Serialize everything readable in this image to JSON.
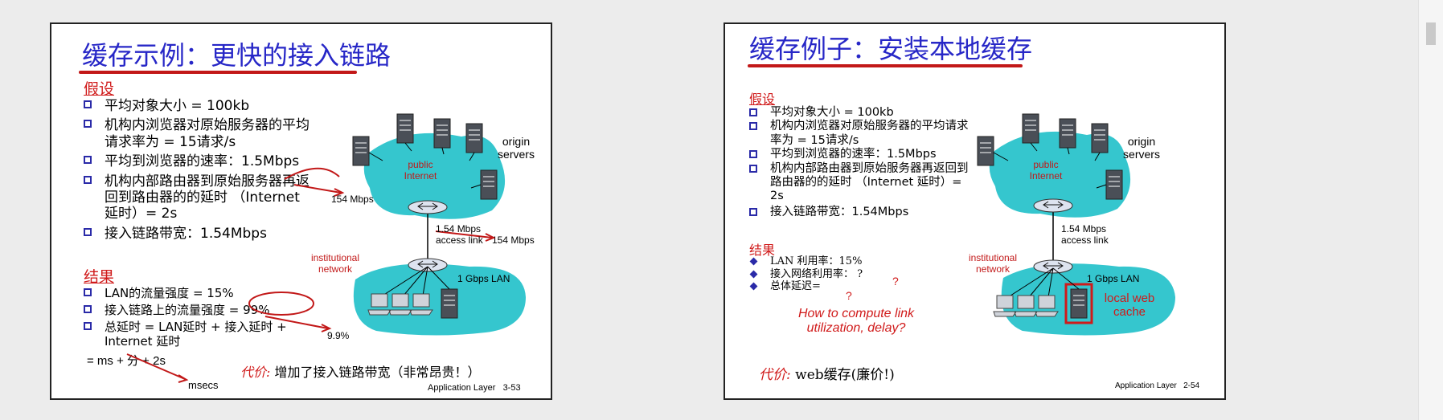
{
  "colors": {
    "title": "#2727c7",
    "accent": "#d01a1a",
    "cloud": "#35c6ce",
    "bullet": "#2a2aa8"
  },
  "slide1": {
    "title": "缓存示例：更快的接入链路",
    "assumptions_heading": "假设",
    "assumptions": [
      "平均对象大小 = 100kb",
      "机构内浏览器对原始服务器的平均请求率为 = 15请求/s",
      "平均到浏览器的速率：1.5Mbps",
      "机构内部路由器到原始服务器再返回到路由器的的延时 （Internet 延时）= 2s",
      "接入链路带宽：1.54Mbps"
    ],
    "results_heading": "结果",
    "results": [
      "LAN的流量强度 = 15%",
      "接入链路上的流量强度 = 99%",
      "总延时   = LAN延时 + 接入延时 + Internet 延时"
    ],
    "equation": "=   ms + 分 + 2s",
    "annot_msecs": "msecs",
    "annot_99": "9.9%",
    "annot_154_top": "154 Mbps",
    "annot_154_right": "154 Mbps",
    "cost_key": "代价:",
    "cost_text": "增加了接入链路带宽（非常昂贵！）",
    "footer": "Application Layer",
    "page": "3-53",
    "diagram": {
      "cloud_label_1": "public",
      "cloud_label_2": "Internet",
      "origin_1": "origin",
      "origin_2": "servers",
      "link_1": "1.54 Mbps",
      "link_2": "access link",
      "inst_1": "institutional",
      "inst_2": "network",
      "lan": "1 Gbps LAN"
    }
  },
  "slide2": {
    "title": "缓存例子：安装本地缓存",
    "assumptions_heading": "假设",
    "assumptions": [
      "平均对象大小 = 100kb",
      "机构内浏览器对原始服务器的平均请求率为 = 15请求/s",
      "平均到浏览器的速率：1.5Mbps",
      "机构内部路由器到原始服务器再返回到路由器的的延时 （Internet 延时）= 2s",
      "接入链路带宽：1.54Mbps"
    ],
    "results_heading": "结果",
    "results": [
      "LAN 利用率：15%",
      "接入网络利用率：  ?",
      "总体延迟="
    ],
    "q1": "?",
    "q2": "?",
    "question_1": "How to compute link",
    "question_2": "utilization, delay?",
    "cost_key": "代价:",
    "cost_text": "web缓存(廉价!)",
    "footer": "Application Layer",
    "page": "2-54",
    "diagram": {
      "cloud_label_1": "public",
      "cloud_label_2": "Internet",
      "origin_1": "origin",
      "origin_2": "servers",
      "link_1": "1.54 Mbps",
      "link_2": "access link",
      "inst_1": "institutional",
      "inst_2": "network",
      "lan": "1 Gbps LAN",
      "cache_1": "local web",
      "cache_2": "cache"
    }
  }
}
